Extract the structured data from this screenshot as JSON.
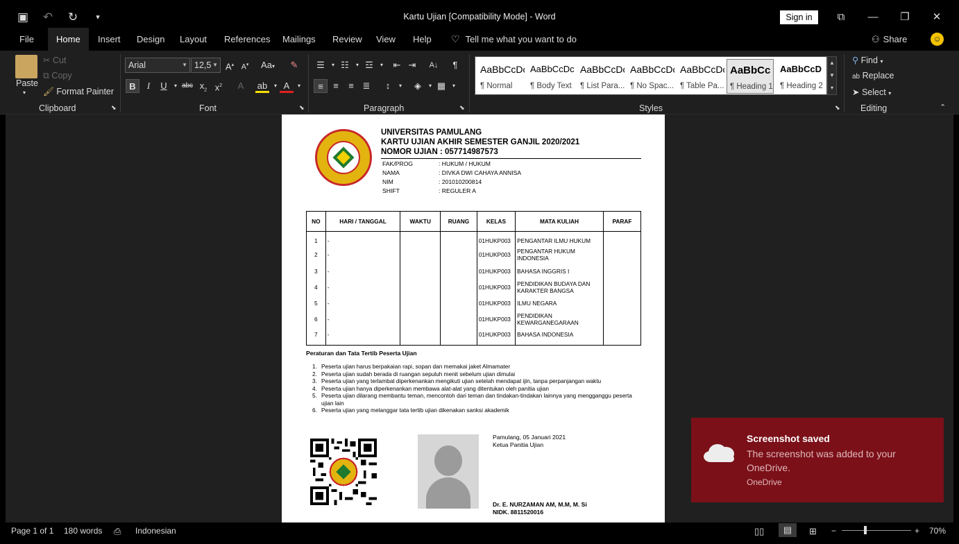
{
  "window": {
    "title": "Kartu Ujian [Compatibility Mode]  -  Word",
    "sign_in": "Sign in"
  },
  "menu": {
    "tabs": [
      "File",
      "Home",
      "Insert",
      "Design",
      "Layout",
      "References",
      "Mailings",
      "Review",
      "View",
      "Help"
    ],
    "active": "Home",
    "tell_me": "Tell me what you want to do",
    "share": "Share"
  },
  "ribbon": {
    "clipboard": {
      "paste": "Paste",
      "cut": "Cut",
      "copy": "Copy",
      "format_painter": "Format Painter",
      "label": "Clipboard"
    },
    "font": {
      "name": "Arial",
      "size": "12,5",
      "label": "Font",
      "case_btn": "Aa"
    },
    "paragraph": {
      "label": "Paragraph"
    },
    "styles": {
      "label": "Styles",
      "items": [
        {
          "preview": "AaBbCcDc",
          "name": "¶ Normal"
        },
        {
          "preview": "AaBbCcDc",
          "name": "¶ Body Text"
        },
        {
          "preview": "AaBbCcDc",
          "name": "¶ List Para..."
        },
        {
          "preview": "AaBbCcDc",
          "name": "¶ No Spac..."
        },
        {
          "preview": "AaBbCcDc",
          "name": "¶ Table Pa..."
        },
        {
          "preview": "AaBbCc",
          "name": "¶ Heading 1"
        },
        {
          "preview": "AaBbCcD",
          "name": "¶ Heading 2"
        }
      ]
    },
    "editing": {
      "find": "Find",
      "replace": "Replace",
      "select": "Select",
      "label": "Editing"
    }
  },
  "document": {
    "header": {
      "line1": "UNIVERSITAS PAMULANG",
      "line2": "KARTU UJIAN AKHIR SEMESTER GANJIL 2020/2021",
      "line3": "NOMOR UJIAN : 057714987573"
    },
    "info": [
      {
        "label": "FAK/PROG",
        "value": ": HUKUM / HUKUM"
      },
      {
        "label": "NAMA",
        "value": ": DIVKA DWI CAHAYA ANNISA"
      },
      {
        "label": "NIM",
        "value": ": 201010200814"
      },
      {
        "label": "SHIFT",
        "value": ": REGULER A"
      }
    ],
    "table": {
      "headers": [
        "NO",
        "HARI / TANGGAL",
        "WAKTU",
        "RUANG",
        "KELAS",
        "MATA KULIAH",
        "PARAF"
      ],
      "rows": [
        {
          "no": "1",
          "tanggal": "-",
          "kelas": "01HUKP003",
          "mk": "PENGANTAR ILMU HUKUM"
        },
        {
          "no": "2",
          "tanggal": "-",
          "kelas": "01HUKP003",
          "mk": "PENGANTAR HUKUM INDONESIA"
        },
        {
          "no": "3",
          "tanggal": "-",
          "kelas": "01HUKP003",
          "mk": "BAHASA INGGRIS I"
        },
        {
          "no": "4",
          "tanggal": "-",
          "kelas": "01HUKP003",
          "mk": "PENDIDIKAN BUDAYA DAN KARAKTER BANGSA"
        },
        {
          "no": "5",
          "tanggal": "-",
          "kelas": "01HUKP003",
          "mk": "ILMU NEGARA"
        },
        {
          "no": "6",
          "tanggal": "-",
          "kelas": "01HUKP003",
          "mk": "PENDIDIKAN KEWARGANEGARAAN"
        },
        {
          "no": "7",
          "tanggal": "-",
          "kelas": "01HUKP003",
          "mk": "BAHASA INDONESIA"
        }
      ]
    },
    "rules_title": "Peraturan dan Tata Tertib Peserta Ujian",
    "rules": [
      "Peserta ujian harus berpakaian rapi, sopan dan memakai jaket Almamater",
      "Peserta ujian sudah berada di ruangan sepuluh menit sebelum ujian dimulai",
      "Peserta ujian yang terlambat diperkenankan mengikuti ujian setelah mendapat ijin, tanpa perpanjangan waktu",
      "Peserta ujian hanya diperkenankan membawa alat-alat yang ditentukan oleh panitia ujian",
      "Peserta ujian dilarang membantu teman, mencontoh dari teman dan tindakan-tindakan lainnya yang mengganggu peserta ujian lain",
      "Peserta ujian yang melanggar tata tertib ujian dikenakan sanksi akademik"
    ],
    "signature": {
      "place_date": "Pamulang, 05 Januari 2021",
      "role": "Ketua Panitia Ujian",
      "name": "Dr. E. NURZAMAN AM, M.M, M. Si",
      "nidk": "NIDK. 8811520016"
    }
  },
  "toast": {
    "title": "Screenshot saved",
    "body": "The screenshot was added to your OneDrive.",
    "source": "OneDrive"
  },
  "status": {
    "page": "Page 1 of 1",
    "words": "180 words",
    "language": "Indonesian",
    "zoom": "70%"
  }
}
